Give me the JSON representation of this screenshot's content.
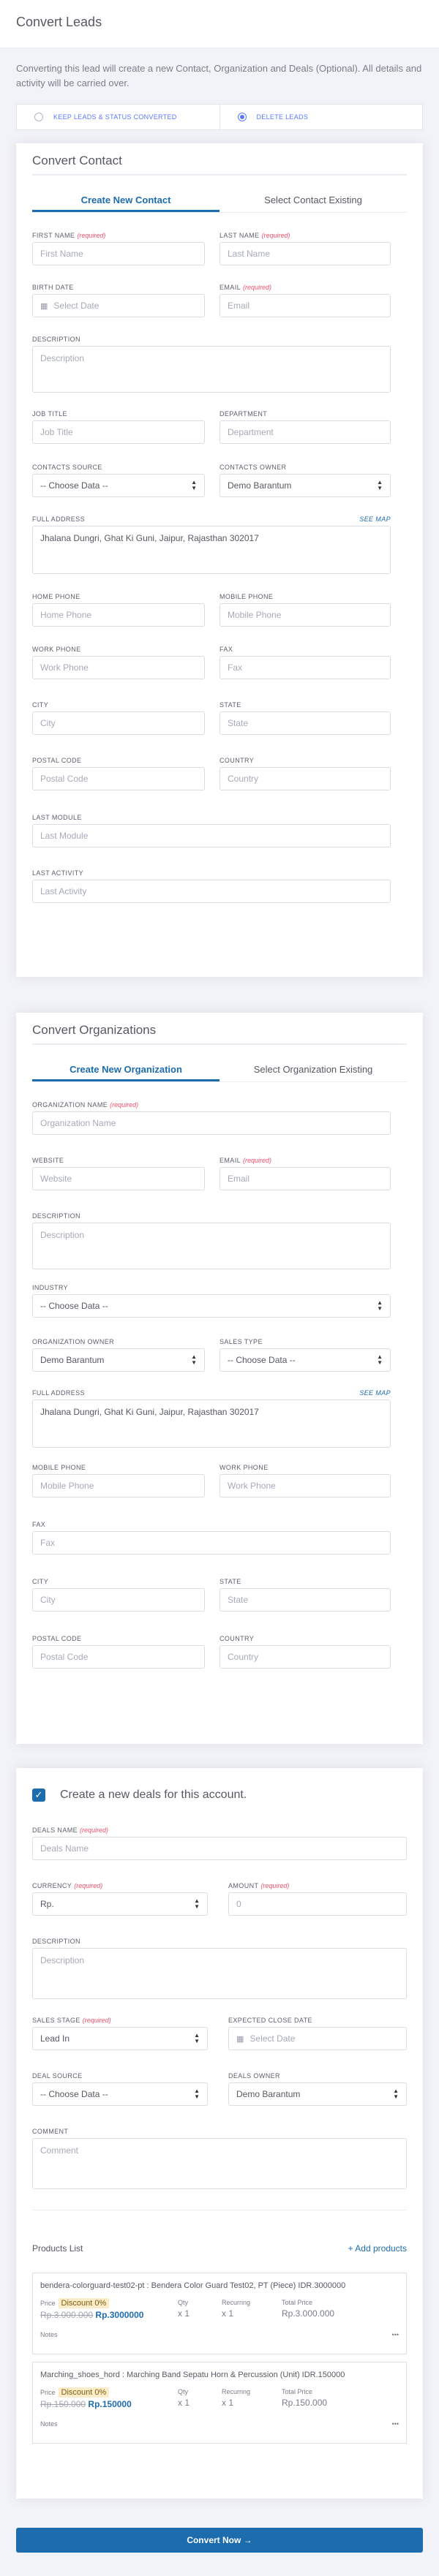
{
  "header": {
    "title": "Convert Leads"
  },
  "intro": "Converting this lead will create a new Contact, Organization and Deals (Optional). All details and activity will be carried over.",
  "radios": {
    "keep": "KEEP LEADS & STATUS CONVERTED",
    "delete": "DELETE LEADS"
  },
  "contact": {
    "title": "Convert Contact",
    "tabs": [
      "Create New Contact",
      "Select Contact Existing"
    ],
    "req": "(required)",
    "see_map": "see map",
    "first_name": {
      "label": "FIRST NAME",
      "placeholder": "First Name"
    },
    "last_name": {
      "label": "LAST NAME",
      "placeholder": "Last Name"
    },
    "birth_date": {
      "label": "BIRTH DATE",
      "placeholder": "Select Date"
    },
    "email": {
      "label": "EMAIL",
      "placeholder": "Email"
    },
    "description": {
      "label": "DESCRIPTION",
      "placeholder": "Description"
    },
    "job_title": {
      "label": "JOB TITLE",
      "placeholder": "Job Title"
    },
    "department": {
      "label": "DEPARTMENT",
      "placeholder": "Department"
    },
    "source": {
      "label": "CONTACTS SOURCE",
      "value": "-- Choose Data --"
    },
    "owner": {
      "label": "CONTACTS OWNER",
      "value": "Demo Barantum"
    },
    "address": {
      "label": "FULL ADDRESS",
      "value": "Jhalana Dungri, Ghat Ki Guni, Jaipur, Rajasthan 302017"
    },
    "home_phone": {
      "label": "HOME PHONE",
      "placeholder": "Home Phone"
    },
    "mobile_phone": {
      "label": "MOBILE PHONE",
      "placeholder": "Mobile Phone"
    },
    "work_phone": {
      "label": "WORK PHONE",
      "placeholder": "Work Phone"
    },
    "fax": {
      "label": "FAX",
      "placeholder": "Fax"
    },
    "city": {
      "label": "CITY",
      "placeholder": "City"
    },
    "state": {
      "label": "STATE",
      "placeholder": "State"
    },
    "postal": {
      "label": "POSTAL CODE",
      "placeholder": "Postal Code"
    },
    "country": {
      "label": "COUNTRY",
      "placeholder": "Country"
    },
    "last_module": {
      "label": "LAST MODULE",
      "placeholder": "Last Module"
    },
    "last_activity": {
      "label": "LAST ACTIVITY",
      "placeholder": "Last Activity"
    }
  },
  "org": {
    "title": "Convert Organizations",
    "tabs": [
      "Create New Organization",
      "Select Organization Existing"
    ],
    "name": {
      "label": "ORGANIZATION NAME",
      "placeholder": "Organization Name"
    },
    "website": {
      "label": "WEBSITE",
      "placeholder": "Website"
    },
    "email": {
      "label": "EMAIL",
      "placeholder": "Email"
    },
    "description": {
      "label": "DESCRIPTION",
      "placeholder": "Description"
    },
    "industry": {
      "label": "INDUSTRY",
      "value": "-- Choose Data --"
    },
    "owner": {
      "label": "ORGANIZATION OWNER",
      "value": "Demo Barantum"
    },
    "sales_type": {
      "label": "SALES TYPE",
      "value": "-- Choose Data --"
    },
    "address": {
      "label": "FULL ADDRESS",
      "value": "Jhalana Dungri, Ghat Ki Guni, Jaipur, Rajasthan 302017"
    },
    "mobile_phone": {
      "label": "MOBILE PHONE",
      "placeholder": "Mobile Phone"
    },
    "work_phone": {
      "label": "WORK PHONE",
      "placeholder": "Work Phone"
    },
    "fax": {
      "label": "FAX",
      "placeholder": "Fax"
    },
    "city": {
      "label": "CITY",
      "placeholder": "City"
    },
    "state": {
      "label": "STATE",
      "placeholder": "State"
    },
    "postal": {
      "label": "POSTAL CODE",
      "placeholder": "Postal Code"
    },
    "country": {
      "label": "COUNTRY",
      "placeholder": "Country"
    }
  },
  "deals": {
    "check_label": "Create a new deals for this account.",
    "name": {
      "label": "DEALS NAME",
      "placeholder": "Deals Name"
    },
    "currency": {
      "label": "CURRENCY",
      "value": "Rp."
    },
    "amount": {
      "label": "AMOUNT",
      "placeholder": "0"
    },
    "description": {
      "label": "DESCRIPTION",
      "placeholder": "Description"
    },
    "stage": {
      "label": "SALES STAGE",
      "value": "Lead In"
    },
    "close_date": {
      "label": "EXPECTED CLOSE DATE",
      "placeholder": "Select Date"
    },
    "source": {
      "label": "DEAL SOURCE",
      "value": "-- Choose Data --"
    },
    "owner": {
      "label": "DEALS OWNER",
      "value": "Demo Barantum"
    },
    "comment": {
      "label": "COMMENT",
      "placeholder": "Comment"
    }
  },
  "products": {
    "title": "Products List",
    "add": "+ Add products",
    "labels": {
      "price": "Price",
      "qty": "Qty",
      "recurring": "Recurring",
      "total": "Total Price",
      "notes": "Notes",
      "discount": "Discount 0%"
    },
    "items": [
      {
        "name": "bendera-colorguard-test02-pt : Bendera Color Guard Test02, PT (Piece) IDR.3000000",
        "old": "Rp.3.000.000",
        "new": "Rp.3000000",
        "qty": "x 1",
        "rec": "x 1",
        "total": "Rp.3.000.000"
      },
      {
        "name": "Marching_shoes_hord : Marching Band Sepatu Horn & Percussion (Unit) IDR.150000",
        "old": "Rp.150.000",
        "new": "Rp.150000",
        "qty": "x 1",
        "rec": "x 1",
        "total": "Rp.150.000"
      }
    ]
  },
  "button": {
    "label": "Convert Now"
  }
}
